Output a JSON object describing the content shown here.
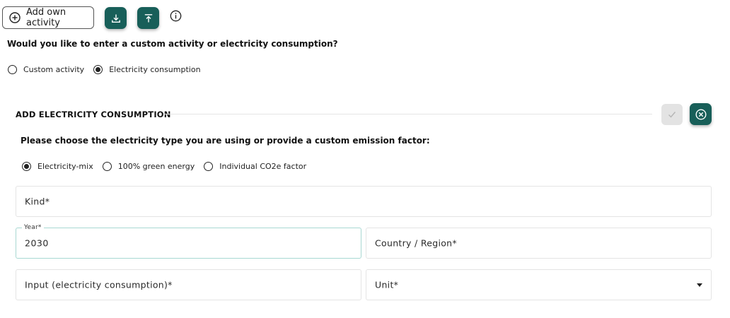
{
  "toolbar": {
    "add_own_activity_label": "Add own activity",
    "download_icon": "download-icon",
    "upload_icon": "upload-icon",
    "info_icon": "info-icon"
  },
  "question": "Would you like to enter a custom activity or electricity consumption?",
  "entry_type": {
    "options": [
      {
        "label": "Custom activity",
        "checked": false
      },
      {
        "label": "Electricity consumption",
        "checked": true
      }
    ]
  },
  "section": {
    "title": "ADD ELECTRICITY CONSUMPTION",
    "confirm_icon": "check-icon",
    "cancel_icon": "close-circle-icon"
  },
  "electricity_type": {
    "prompt": "Please choose the electricity type you are using or provide a custom emission factor:",
    "options": [
      {
        "label": "Electricity-mix",
        "checked": true
      },
      {
        "label": "100% green energy",
        "checked": false
      },
      {
        "label": "Individual CO2e factor",
        "checked": false
      }
    ]
  },
  "form": {
    "kind": {
      "placeholder": "Kind*"
    },
    "year": {
      "label": "Year*",
      "value": "2030"
    },
    "country": {
      "placeholder": "Country / Region*"
    },
    "input": {
      "placeholder": "Input (electricity consumption)*"
    },
    "unit": {
      "placeholder": "Unit*"
    }
  },
  "colors": {
    "accent": "#185f59",
    "active_border": "#a8d8d2",
    "disabled_button": "#e3e3e3"
  }
}
